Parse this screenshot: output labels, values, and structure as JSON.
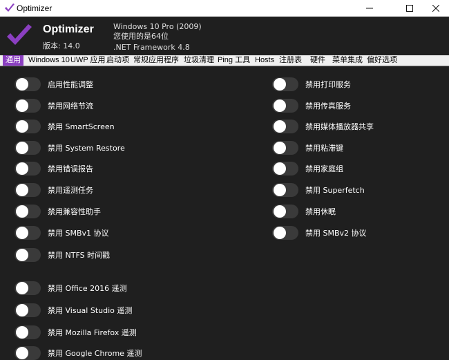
{
  "window": {
    "title": "Optimizer",
    "controls": {
      "minimize": "—",
      "maximize": "☐",
      "close": "✕"
    }
  },
  "header": {
    "app_name": "Optimizer",
    "version": "版本: 14.0",
    "os": "Windows 10 Pro (2009)",
    "bitness": "您使用的是64位",
    "framework": ".NET Framework 4.8",
    "logo_icon": "checkmark-icon",
    "accent": "#8b3fc1"
  },
  "tabs": [
    "通用",
    "Windows 10",
    "UWP 应用",
    "启动项",
    "常规应用程序",
    "垃圾清理",
    "Ping 工具",
    "Hosts",
    "注册表",
    "硬件",
    "菜单集成",
    "偏好选项"
  ],
  "active_tab": "通用",
  "left_options": [
    "启用性能调整",
    "禁用网络节流",
    "禁用 SmartScreen",
    "禁用 System Restore",
    "禁用错误报告",
    "禁用遥测任务",
    "禁用兼容性助手",
    "禁用 SMBv1 协议",
    "禁用 NTFS 时间戳"
  ],
  "right_options": [
    "禁用打印服务",
    "禁用传真服务",
    "禁用媒体播放器共享",
    "禁用粘滞键",
    "禁用家庭组",
    "禁用 Superfetch",
    "禁用休眠",
    "禁用 SMBv2 协议"
  ],
  "app_options": [
    "禁用 Office 2016 遥测",
    "禁用 Visual Studio 遥测",
    "禁用 Mozilla Firefox 遥测",
    "禁用 Google Chrome 遥测"
  ]
}
